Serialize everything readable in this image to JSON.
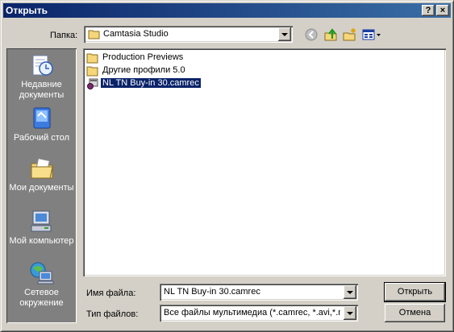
{
  "window": {
    "title": "Открыть",
    "help_label": "?",
    "close_label": "×"
  },
  "lookin": {
    "label": "Папка:",
    "value": "Camtasia Studio"
  },
  "places": [
    {
      "label": "Недавние документы",
      "icon": "recent-documents-icon"
    },
    {
      "label": "Рабочий стол",
      "icon": "desktop-icon"
    },
    {
      "label": "Мои документы",
      "icon": "my-documents-icon"
    },
    {
      "label": "Мой компьютер",
      "icon": "my-computer-icon"
    },
    {
      "label": "Сетевое окружение",
      "icon": "network-places-icon"
    }
  ],
  "files": [
    {
      "name": "Production Previews",
      "type": "folder"
    },
    {
      "name": "Другие профили 5.0",
      "type": "folder"
    },
    {
      "name": "NL TN Buy-in 30.camrec",
      "type": "camrec",
      "selected": true
    }
  ],
  "filename": {
    "label": "Имя файла:",
    "value": "NL TN Buy-in 30.camrec"
  },
  "filetype": {
    "label": "Тип файлов:",
    "value": "Все файлы мультимедиа (*.camrec, *.avi,*.mp"
  },
  "buttons": {
    "open": "Открыть",
    "cancel": "Отмена"
  },
  "toolbar": [
    "back-icon",
    "up-folder-icon",
    "new-folder-icon",
    "views-menu-icon"
  ]
}
